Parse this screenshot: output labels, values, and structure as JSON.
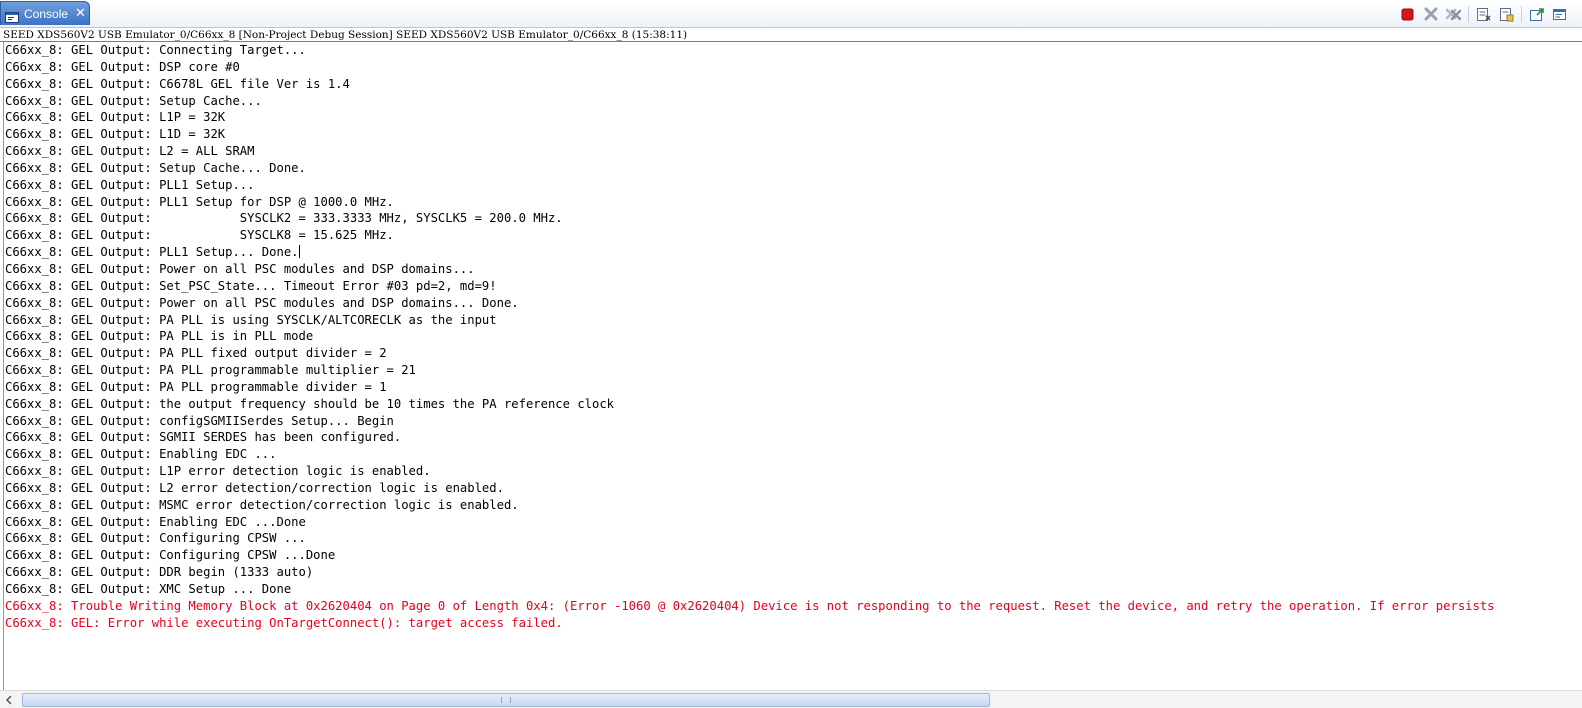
{
  "tab": {
    "label": "Console",
    "icon": "console-icon",
    "close_icon": "close-icon"
  },
  "toolbar": {
    "buttons": [
      {
        "name": "terminate-icon",
        "color": "#d8141c"
      },
      {
        "name": "remove-launch-icon",
        "color": "#8b93a3"
      },
      {
        "name": "remove-all-terminated-icon",
        "color": "#8b93a3"
      },
      {
        "name": "clear-console-icon",
        "color": "#5b6e8c"
      },
      {
        "name": "scroll-lock-icon",
        "color": "#c9a23a"
      },
      {
        "name": "pin-console-icon",
        "color": "#2a8f3c"
      },
      {
        "name": "display-console-icon",
        "color": "#3b6db3"
      }
    ]
  },
  "session": {
    "title": "SEED XDS560V2 USB Emulator_0/C66xx_8 [Non-Project Debug Session] SEED XDS560V2 USB Emulator_0/C66xx_8 (15:38:11)"
  },
  "console": {
    "lines": [
      {
        "text": "C66xx_8: GEL Output: Connecting Target...",
        "error": false
      },
      {
        "text": "C66xx_8: GEL Output: DSP core #0",
        "error": false
      },
      {
        "text": "C66xx_8: GEL Output: C6678L GEL file Ver is 1.4",
        "error": false
      },
      {
        "text": "C66xx_8: GEL Output: Setup Cache...",
        "error": false
      },
      {
        "text": "C66xx_8: GEL Output: L1P = 32K",
        "error": false
      },
      {
        "text": "C66xx_8: GEL Output: L1D = 32K",
        "error": false
      },
      {
        "text": "C66xx_8: GEL Output: L2 = ALL SRAM",
        "error": false
      },
      {
        "text": "C66xx_8: GEL Output: Setup Cache... Done.",
        "error": false
      },
      {
        "text": "C66xx_8: GEL Output: PLL1 Setup...",
        "error": false
      },
      {
        "text": "C66xx_8: GEL Output: PLL1 Setup for DSP @ 1000.0 MHz.",
        "error": false
      },
      {
        "text": "C66xx_8: GEL Output:            SYSCLK2 = 333.3333 MHz, SYSCLK5 = 200.0 MHz.",
        "error": false
      },
      {
        "text": "C66xx_8: GEL Output:            SYSCLK8 = 15.625 MHz.",
        "error": false
      },
      {
        "text": "C66xx_8: GEL Output: PLL1 Setup... Done.",
        "error": false
      },
      {
        "text": "C66xx_8: GEL Output: Power on all PSC modules and DSP domains...",
        "error": false
      },
      {
        "text": "C66xx_8: GEL Output: Set_PSC_State... Timeout Error #03 pd=2, md=9!",
        "error": false
      },
      {
        "text": "C66xx_8: GEL Output: Power on all PSC modules and DSP domains... Done.",
        "error": false
      },
      {
        "text": "C66xx_8: GEL Output: PA PLL is using SYSCLK/ALTCORECLK as the input",
        "error": false
      },
      {
        "text": "C66xx_8: GEL Output: PA PLL is in PLL mode",
        "error": false
      },
      {
        "text": "C66xx_8: GEL Output: PA PLL fixed output divider = 2",
        "error": false
      },
      {
        "text": "C66xx_8: GEL Output: PA PLL programmable multiplier = 21",
        "error": false
      },
      {
        "text": "C66xx_8: GEL Output: PA PLL programmable divider = 1",
        "error": false
      },
      {
        "text": "C66xx_8: GEL Output: the output frequency should be 10 times the PA reference clock",
        "error": false
      },
      {
        "text": "C66xx_8: GEL Output: configSGMIISerdes Setup... Begin",
        "error": false
      },
      {
        "text": "C66xx_8: GEL Output: SGMII SERDES has been configured.",
        "error": false
      },
      {
        "text": "C66xx_8: GEL Output: Enabling EDC ...",
        "error": false
      },
      {
        "text": "C66xx_8: GEL Output: L1P error detection logic is enabled.",
        "error": false
      },
      {
        "text": "C66xx_8: GEL Output: L2 error detection/correction logic is enabled.",
        "error": false
      },
      {
        "text": "C66xx_8: GEL Output: MSMC error detection/correction logic is enabled.",
        "error": false
      },
      {
        "text": "C66xx_8: GEL Output: Enabling EDC ...Done",
        "error": false
      },
      {
        "text": "C66xx_8: GEL Output: Configuring CPSW ...",
        "error": false
      },
      {
        "text": "C66xx_8: GEL Output: Configuring CPSW ...Done",
        "error": false
      },
      {
        "text": "C66xx_8: GEL Output: DDR begin (1333 auto)",
        "error": false
      },
      {
        "text": "C66xx_8: GEL Output: XMC Setup ... Done",
        "error": false
      },
      {
        "text": "C66xx_8: Trouble Writing Memory Block at 0x2620404 on Page 0 of Length 0x4: (Error -1060 @ 0x2620404) Device is not responding to the request. Reset the device, and retry the operation. If error persists",
        "error": true
      },
      {
        "text": "C66xx_8: GEL: Error while executing OnTargetConnect(): target access failed.",
        "error": true
      }
    ]
  },
  "colors": {
    "error_text": "#e8001c",
    "normal_text": "#000000",
    "tab_active": "#3d73c6"
  }
}
